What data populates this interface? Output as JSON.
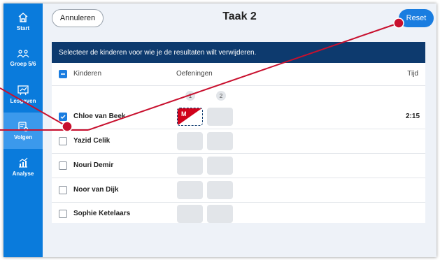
{
  "sidebar": {
    "items": [
      {
        "label": "Start",
        "icon": "home-icon"
      },
      {
        "label": "Groep 5/6",
        "icon": "group-icon"
      },
      {
        "label": "Lesgeven",
        "icon": "teach-icon"
      },
      {
        "label": "Volgen",
        "icon": "follow-icon",
        "active": true
      },
      {
        "label": "Analyse",
        "icon": "analysis-icon"
      }
    ]
  },
  "header": {
    "cancel_label": "Annuleren",
    "title": "Taak 2",
    "reset_label": "Reset"
  },
  "panel": {
    "banner": "Selecteer de kinderen voor wie je de resultaten wilt verwijderen.",
    "columns": {
      "children": "Kinderen",
      "exercises": "Oefeningen",
      "time": "Tijd"
    },
    "exercise_numbers": [
      "1",
      "2"
    ],
    "rows": [
      {
        "name": "Chloe van Beek",
        "checked": true,
        "result_badge": "M",
        "time": "2:15"
      },
      {
        "name": "Yazid Celik",
        "checked": false,
        "time": ""
      },
      {
        "name": "Nouri Demir",
        "checked": false,
        "time": ""
      },
      {
        "name": "Noor van Dijk",
        "checked": false,
        "time": ""
      },
      {
        "name": "Sophie Ketelaars",
        "checked": false,
        "time": ""
      }
    ]
  },
  "colors": {
    "sidebar": "#0a7bdc",
    "banner": "#0d3a6e",
    "accent": "#1a7de0",
    "annotation": "#d0021b"
  }
}
